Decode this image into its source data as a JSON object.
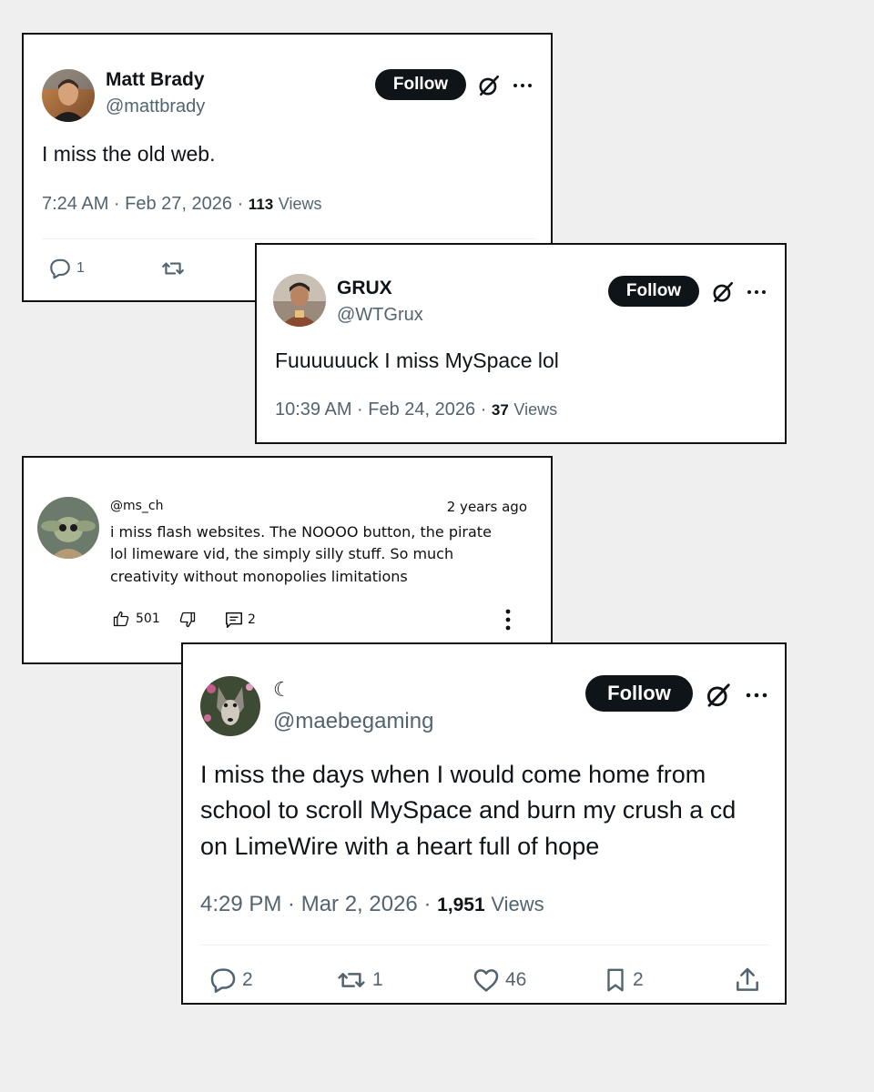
{
  "posts": [
    {
      "name": "Matt Brady",
      "handle": "@mattbrady",
      "follow_label": "Follow",
      "text": "I miss the old web.",
      "time": "7:24 AM · Feb 27, 2026 · ",
      "views_count": "113",
      "views_label": "Views",
      "replies": "1"
    },
    {
      "name": "GRUX",
      "handle": "@WTGrux",
      "follow_label": "Follow",
      "text": "Fuuuuuuck I miss MySpace lol",
      "time": "10:39 AM · Feb 24, 2026 · ",
      "views_count": "37",
      "views_label": "Views"
    },
    {
      "handle": "@ms_ch",
      "age": "2 years ago",
      "lines": [
        "i miss flash websites. The NOOOO button, the pirate",
        "lol limeware vid, the simply silly stuff. So much",
        "creativity without monopolies limitations"
      ],
      "likes": "501",
      "replies": "2"
    },
    {
      "name": "☾",
      "handle": "@maebegaming",
      "follow_label": "Follow",
      "lines": [
        "I miss the days when I would come home from",
        "school to scroll MySpace and burn my crush a cd",
        "on LimeWire with a heart full of hope"
      ],
      "time": "4:29 PM · Mar 2, 2026 · ",
      "views_count": "1,951",
      "views_label": "Views",
      "replies": "2",
      "reposts": "1",
      "likes": "46",
      "bookmarks": "2"
    }
  ],
  "icons": {
    "grok": "grok-icon",
    "more": "more-icon",
    "reply": "reply-icon",
    "repost": "repost-icon",
    "like": "like-icon",
    "bookmark": "bookmark-icon",
    "share": "share-icon",
    "thumbs_up": "thumbs-up-icon",
    "thumbs_down": "thumbs-down-icon",
    "comment": "comment-icon",
    "kebab": "kebab-menu-icon"
  }
}
